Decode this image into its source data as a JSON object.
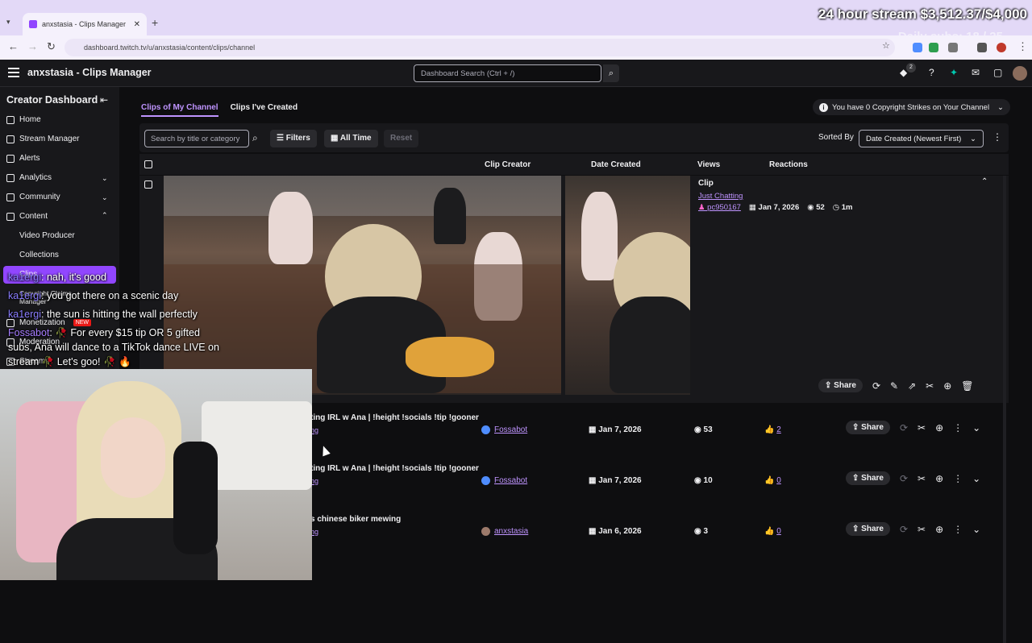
{
  "browser": {
    "tab_title": "anxstasia - Clips Manager",
    "new_tab": "+",
    "url": "dashboard.twitch.tv/u/anxstasia/content/clips/channel"
  },
  "overlay": {
    "goal": "24 hour stream $3,512.37/$4,000",
    "subs": "Daily subs: 18 / 25"
  },
  "topbar": {
    "title": "anxstasia - Clips Manager",
    "search_placeholder": "Dashboard Search (Ctrl + /)",
    "notif_count": "2"
  },
  "sidebar": {
    "header": "Creator Dashboard",
    "items": [
      {
        "label": "Home"
      },
      {
        "label": "Stream Manager"
      },
      {
        "label": "Alerts"
      },
      {
        "label": "Analytics"
      },
      {
        "label": "Community"
      },
      {
        "label": "Content"
      }
    ],
    "sub_items": [
      "Video Producer",
      "Collections",
      "Clips",
      "Copyright Claims Manager"
    ],
    "more": [
      {
        "label": "Monetization",
        "badge": "NEW"
      },
      {
        "label": "Moderation"
      },
      {
        "label": "Streams"
      }
    ]
  },
  "main": {
    "tabs": [
      "Clips of My Channel",
      "Clips I've Created"
    ],
    "strikes": "You have 0 Copyright Strikes on Your Channel",
    "search_placeholder": "Search by title or category",
    "filters": "Filters",
    "time": "All Time",
    "reset": "Reset",
    "sorted_by": "Sorted By",
    "sort_value": "Date Created (Newest First)",
    "columns": [
      "Clip Creator",
      "Date Created",
      "Views",
      "Reactions"
    ]
  },
  "expanded_clip": {
    "title": "Clip",
    "category": "Just Chatting",
    "creator": "pc950167",
    "date": "Jan 7, 2026",
    "views": "52",
    "duration": "1m",
    "share": "Share"
  },
  "rows": [
    {
      "title": "ting IRL w Ana | !height !socials !tip !gooner",
      "category": "ng",
      "creator": "Fossabot",
      "date": "Jan 7, 2026",
      "views": "53",
      "reactions": "2",
      "share": "Share"
    },
    {
      "title": "ting IRL w Ana | !height !socials !tip !gooner",
      "category": "ng",
      "creator": "Fossabot",
      "date": "Jan 7, 2026",
      "views": "10",
      "reactions": "0",
      "share": "Share"
    },
    {
      "title": "s chinese biker mewing",
      "category": "ng",
      "creator": "anxstasia",
      "date": "Jan 6, 2026",
      "views": "3",
      "reactions": "0",
      "share": "Share"
    }
  ],
  "chat": [
    {
      "user": "ka1ergi",
      "text": "nah, it's good"
    },
    {
      "user": "ka1ergi",
      "text": "you got there on a scenic day"
    },
    {
      "user": "ka1ergi",
      "text": "the sun is hitting the wall perfectly"
    },
    {
      "user": "Fossabot",
      "text": "🥀 For every $15 tip OR 5 gifted"
    },
    {
      "user": "",
      "text": "subs, Ana will dance to a TikTok dance LIVE on"
    },
    {
      "user": "",
      "text": "stream 🥀 Let's goo! 🥀 🔥"
    }
  ],
  "colors": {
    "accent": "#9146ff",
    "link": "#bf94ff",
    "bg": "#0e0e10",
    "panel": "#18181b"
  }
}
